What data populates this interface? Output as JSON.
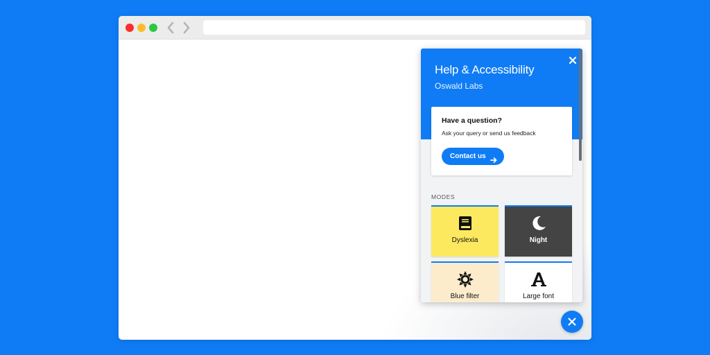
{
  "browser": {
    "url": ""
  },
  "panel": {
    "title": "Help & Accessibility",
    "subtitle": "Oswald Labs",
    "question_card": {
      "title": "Have a question?",
      "text": "Ask your query or send us feedback",
      "button_label": "Contact us"
    },
    "modes_label": "MODES",
    "modes": [
      {
        "label": "Dyslexia",
        "icon": "book-icon"
      },
      {
        "label": "Night",
        "icon": "moon-icon"
      },
      {
        "label": "Blue filter",
        "icon": "sun-icon"
      },
      {
        "label": "Large font",
        "icon": "letter-a-icon"
      }
    ]
  },
  "colors": {
    "background": "#0f7cf6",
    "accent": "#0f7cf6",
    "dyslexia_tile": "#fde960",
    "night_tile": "#444444",
    "blue_filter_tile": "#fdeccc",
    "large_font_tile": "#ffffff"
  }
}
